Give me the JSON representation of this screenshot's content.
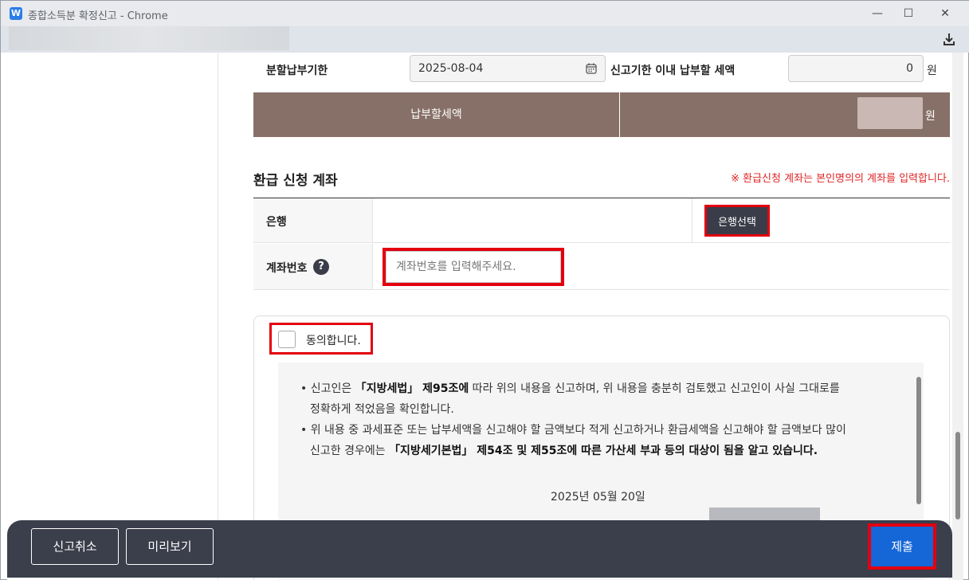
{
  "window": {
    "title": "종합소득분 확정신고 - Chrome",
    "app_icon_letter": "W"
  },
  "payment": {
    "installment_deadline_label": "분할납부기한",
    "installment_deadline_value": "2025-08-04",
    "within_deadline_label": "신고기한 이내 납부할 세액",
    "within_deadline_amount": "0",
    "currency_unit": "원",
    "total_tax_label": "납부할세액",
    "total_tax_unit": "원"
  },
  "refund": {
    "section_title": "환급 신청 계좌",
    "notice": "※ 환급신청 계좌는 본인명의의 계좌를 입력합니다.",
    "bank_label": "은행",
    "bank_button": "은행선택",
    "account_label": "계좌번호",
    "help_glyph": "?",
    "account_placeholder": "계좌번호를 입력해주세요."
  },
  "agreement": {
    "checkbox_label": "동의합니다.",
    "para1_a": "신고인은 ",
    "para1_b": "「지방세법」 제95조에",
    "para1_c": " 따라 위의 내용을 신고하며, 위 내용을 충분히 검토했고 신고인이 사실 그대로를",
    "para1_d": "정확하게 적었음을 확인합니다.",
    "para2_a": "위 내용 중 과세표준 또는 납부세액을 신고해야 할 금액보다 적게 신고하거나 환급세액을 신고해야 할 금액보다 많이",
    "para2_b": "신고한 경우에는 ",
    "para2_c": "「지방세기본법」 제54조 및 제55조에 따른 가산세 부과 등의 대상이 됨을 알고 있습니다.",
    "date": "2025년 05월 20일"
  },
  "bottom": {
    "cancel_button": "신고취소",
    "preview_button": "미리보기",
    "submit_button": "제출"
  },
  "colors": {
    "brown": "#867068",
    "highlight_red": "#e3000f",
    "submit_blue": "#1566d6",
    "dark_bar": "#3b3e4b"
  }
}
